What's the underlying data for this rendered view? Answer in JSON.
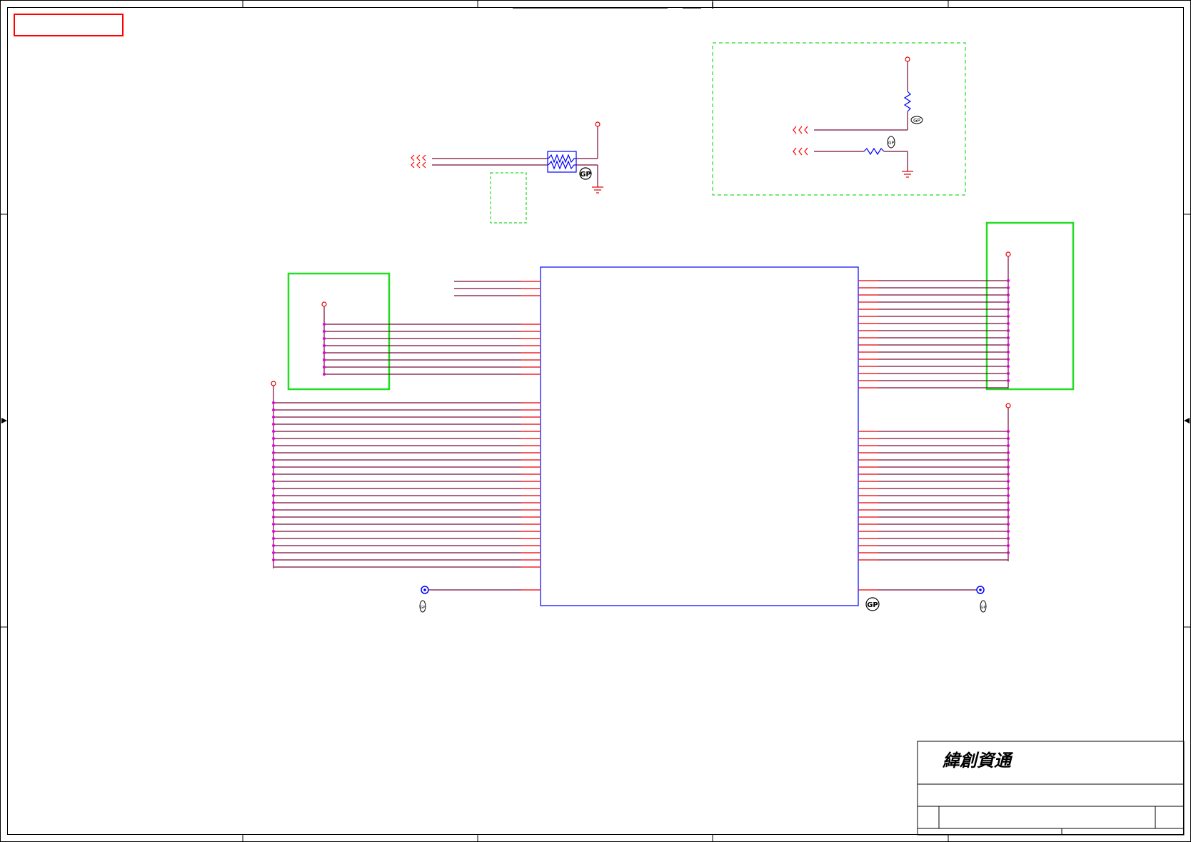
{
  "title_block": {
    "company": "緯創資通"
  },
  "colors": {
    "frame": "#000000",
    "wire": "#7a0a3c",
    "pin_stub": "#ff2020",
    "component": "#0000ff",
    "power": "#e00000",
    "junction": "#e000e0",
    "highlight_green": "#22dd22",
    "dashed_green": "#22dd22",
    "red_box": "#ff0000"
  },
  "icons": {
    "gp_symbol": "GP",
    "offpage_connector": "chevron-arrows",
    "ground": "ground-symbol",
    "test_point": "test-point-circle"
  }
}
